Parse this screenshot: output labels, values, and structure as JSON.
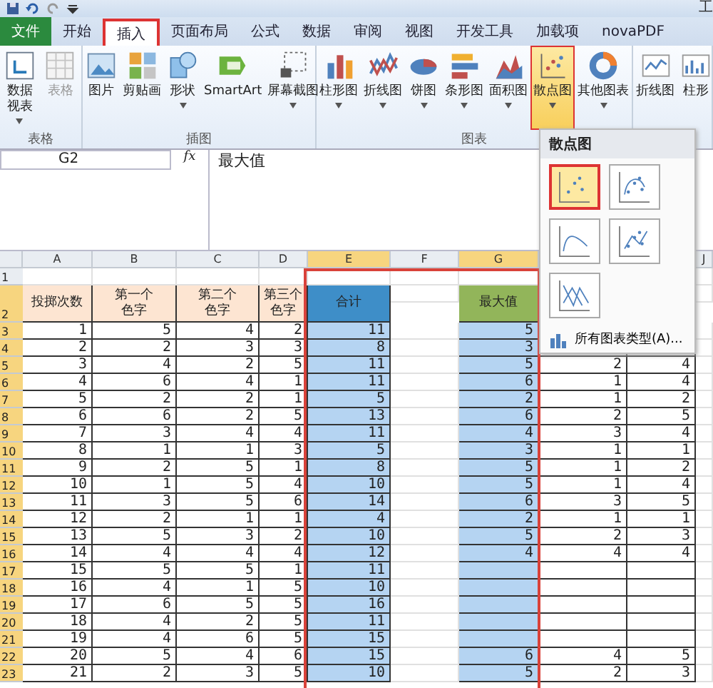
{
  "window_title": "工",
  "tabs": [
    {
      "label": "文件",
      "kind": "file",
      "selected": false
    },
    {
      "label": "开始",
      "kind": "tab",
      "selected": false
    },
    {
      "label": "插入",
      "kind": "tab",
      "selected": true
    },
    {
      "label": "页面布局",
      "kind": "tab",
      "selected": false
    },
    {
      "label": "公式",
      "kind": "tab",
      "selected": false
    },
    {
      "label": "数据",
      "kind": "tab",
      "selected": false
    },
    {
      "label": "审阅",
      "kind": "tab",
      "selected": false
    },
    {
      "label": "视图",
      "kind": "tab",
      "selected": false
    },
    {
      "label": "开发工具",
      "kind": "tab",
      "selected": false
    },
    {
      "label": "加载项",
      "kind": "tab",
      "selected": false
    },
    {
      "label": "novaPDF",
      "kind": "tab",
      "selected": false
    }
  ],
  "ribbon_groups": [
    {
      "label": "表格",
      "buttons": [
        {
          "label": "数据视表",
          "dropdown": true,
          "disabled": false,
          "selected": false
        },
        {
          "label": "表格",
          "dropdown": false,
          "disabled": true,
          "selected": false
        }
      ]
    },
    {
      "label": "插图",
      "buttons": [
        {
          "label": "图片",
          "dropdown": false,
          "disabled": false,
          "selected": false
        },
        {
          "label": "剪贴画",
          "dropdown": false,
          "disabled": false,
          "selected": false
        },
        {
          "label": "形状",
          "dropdown": true,
          "disabled": false,
          "selected": false
        },
        {
          "label": "SmartArt",
          "dropdown": false,
          "disabled": false,
          "selected": false
        },
        {
          "label": "屏幕截图",
          "dropdown": true,
          "disabled": false,
          "selected": false
        }
      ]
    },
    {
      "label": "图表",
      "buttons": [
        {
          "label": "柱形图",
          "dropdown": true,
          "disabled": false,
          "selected": false
        },
        {
          "label": "折线图",
          "dropdown": true,
          "disabled": false,
          "selected": false
        },
        {
          "label": "饼图",
          "dropdown": true,
          "disabled": false,
          "selected": false
        },
        {
          "label": "条形图",
          "dropdown": true,
          "disabled": false,
          "selected": false
        },
        {
          "label": "面积图",
          "dropdown": true,
          "disabled": false,
          "selected": false
        },
        {
          "label": "散点图",
          "dropdown": true,
          "disabled": false,
          "selected": true
        },
        {
          "label": "其他图表",
          "dropdown": true,
          "disabled": false,
          "selected": false
        }
      ]
    },
    {
      "buttons": [
        {
          "label": "折线图",
          "dropdown": false,
          "disabled": false,
          "selected": false
        },
        {
          "label": "柱形",
          "dropdown": false,
          "disabled": false,
          "selected": false
        }
      ]
    }
  ],
  "formula_bar": {
    "name_box": "G2",
    "function_label": "fx",
    "formula": "最大值"
  },
  "columns": [
    {
      "letter": "A",
      "selected": false
    },
    {
      "letter": "B",
      "selected": false
    },
    {
      "letter": "C",
      "selected": false
    },
    {
      "letter": "D",
      "selected": false
    },
    {
      "letter": "E",
      "selected": true
    },
    {
      "letter": "F",
      "selected": false
    },
    {
      "letter": "G",
      "selected": true
    },
    {
      "selected": false
    },
    {
      "selected": false
    },
    {
      "letter": "J",
      "selected": false
    }
  ],
  "rows": [
    {
      "number": "1",
      "selected": false,
      "cells": []
    },
    {
      "number": "2",
      "selected": true,
      "cells": [
        "投掷次数",
        "第一个色字",
        "第二个色字",
        "第三个色字",
        "合计",
        null,
        "最大值"
      ]
    },
    {
      "number": "3",
      "selected": true,
      "cells": [
        "1",
        "5",
        "4",
        "2",
        "11",
        null,
        "5"
      ]
    },
    {
      "number": "4",
      "selected": true,
      "cells": [
        "2",
        "2",
        "3",
        "3",
        "8",
        null,
        "3"
      ]
    },
    {
      "number": "5",
      "selected": true,
      "cells": [
        "3",
        "4",
        "2",
        "5",
        "11",
        null,
        "5",
        "2",
        "4"
      ]
    },
    {
      "number": "6",
      "selected": true,
      "cells": [
        "4",
        "6",
        "4",
        "1",
        "11",
        null,
        "6",
        "1",
        "4"
      ]
    },
    {
      "number": "7",
      "selected": true,
      "cells": [
        "5",
        "2",
        "2",
        "1",
        "5",
        null,
        "2",
        "1",
        "2"
      ]
    },
    {
      "number": "8",
      "selected": true,
      "cells": [
        "6",
        "6",
        "2",
        "5",
        "13",
        null,
        "6",
        "2",
        "5"
      ]
    },
    {
      "number": "9",
      "selected": true,
      "cells": [
        "7",
        "3",
        "4",
        "4",
        "11",
        null,
        "4",
        "3",
        "4"
      ]
    },
    {
      "number": "10",
      "selected": true,
      "cells": [
        "8",
        "1",
        "1",
        "3",
        "5",
        null,
        "3",
        "1",
        "1"
      ]
    },
    {
      "number": "11",
      "selected": true,
      "cells": [
        "9",
        "2",
        "5",
        "1",
        "8",
        null,
        "5",
        "1",
        "2"
      ]
    },
    {
      "number": "12",
      "selected": true,
      "cells": [
        "10",
        "1",
        "5",
        "4",
        "10",
        null,
        "5",
        "1",
        "4"
      ]
    },
    {
      "number": "13",
      "selected": true,
      "cells": [
        "11",
        "3",
        "5",
        "6",
        "14",
        null,
        "6",
        "3",
        "5"
      ]
    },
    {
      "number": "14",
      "selected": true,
      "cells": [
        "12",
        "2",
        "1",
        "1",
        "4",
        null,
        "2",
        "1",
        "1"
      ]
    },
    {
      "number": "15",
      "selected": true,
      "cells": [
        "13",
        "5",
        "3",
        "2",
        "10",
        null,
        "5",
        "2",
        "3"
      ]
    },
    {
      "number": "16",
      "selected": true,
      "cells": [
        "14",
        "4",
        "4",
        "4",
        "12",
        null,
        "4",
        "4",
        "4"
      ]
    },
    {
      "number": "17",
      "selected": true,
      "cells": [
        "15",
        "5",
        "5",
        "1",
        "11"
      ]
    },
    {
      "number": "18",
      "selected": true,
      "cells": [
        "16",
        "4",
        "1",
        "5",
        "10"
      ]
    },
    {
      "number": "19",
      "selected": true,
      "cells": [
        "17",
        "6",
        "5",
        "5",
        "16"
      ]
    },
    {
      "number": "20",
      "selected": true,
      "cells": [
        "18",
        "4",
        "2",
        "5",
        "11"
      ]
    },
    {
      "number": "21",
      "selected": true,
      "cells": [
        "19",
        "4",
        "6",
        "5",
        "15"
      ]
    },
    {
      "number": "22",
      "selected": true,
      "cells": [
        "20",
        "5",
        "4",
        "6",
        "15",
        null,
        "6",
        "4",
        "5"
      ]
    },
    {
      "number": "23",
      "selected": true,
      "cells": [
        "21",
        "2",
        "3",
        "5",
        "10",
        null,
        "5",
        "2",
        "3"
      ]
    }
  ],
  "scatter_menu": {
    "title": "散点图",
    "options": [
      {
        "selected": true
      },
      {
        "selected": false
      },
      {
        "selected": false
      },
      {
        "selected": false
      },
      {
        "selected": false
      }
    ],
    "footer": "所有图表类型(A)..."
  }
}
